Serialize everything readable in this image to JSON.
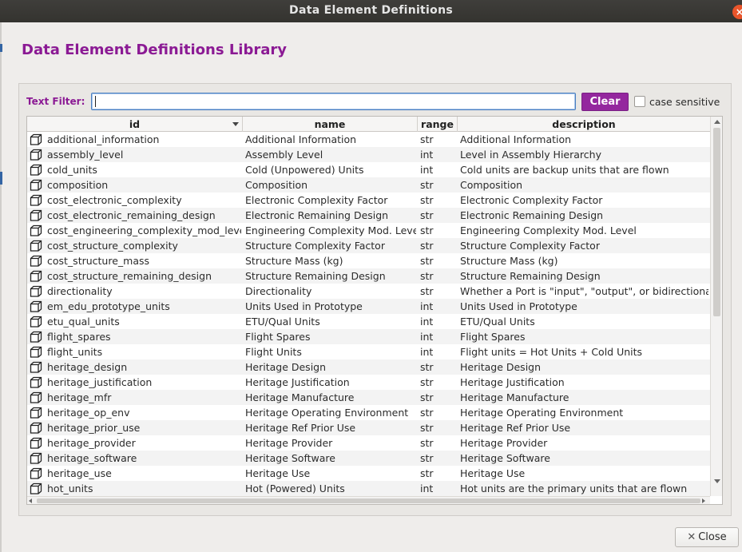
{
  "window": {
    "title": "Data Element Definitions",
    "close_icon": "close-icon"
  },
  "heading": "Data Element Definitions Library",
  "filter": {
    "label": "Text Filter:",
    "value": "",
    "clear_label": "Clear",
    "case_sensitive_label": "case sensitive",
    "case_sensitive_checked": false
  },
  "colors": {
    "accent": "#8b1a94",
    "button": "#94279e",
    "row_alt": "#f3f3f3"
  },
  "table": {
    "columns": [
      "id",
      "name",
      "range",
      "description"
    ],
    "sorted_column": "id",
    "row_icon": "cube-icon",
    "rows": [
      {
        "id": "additional_information",
        "name": "Additional Information",
        "range": "str",
        "description": "Additional Information"
      },
      {
        "id": "assembly_level",
        "name": "Assembly Level",
        "range": "int",
        "description": "Level in Assembly Hierarchy"
      },
      {
        "id": "cold_units",
        "name": "Cold (Unpowered) Units",
        "range": "int",
        "description": "Cold units are backup units that are flown"
      },
      {
        "id": "composition",
        "name": "Composition",
        "range": "str",
        "description": "Composition"
      },
      {
        "id": "cost_electronic_complexity",
        "name": "Electronic Complexity Factor",
        "range": "str",
        "description": "Electronic Complexity Factor"
      },
      {
        "id": "cost_electronic_remaining_design",
        "name": "Electronic Remaining Design",
        "range": "str",
        "description": "Electronic Remaining Design"
      },
      {
        "id": "cost_engineering_complexity_mod_level",
        "name": "Engineering Complexity Mod. Level",
        "range": "str",
        "description": "Engineering Complexity Mod. Level"
      },
      {
        "id": "cost_structure_complexity",
        "name": "Structure Complexity Factor",
        "range": "str",
        "description": "Structure Complexity Factor"
      },
      {
        "id": "cost_structure_mass",
        "name": "Structure Mass (kg)",
        "range": "str",
        "description": "Structure Mass (kg)"
      },
      {
        "id": "cost_structure_remaining_design",
        "name": "Structure Remaining Design",
        "range": "str",
        "description": "Structure Remaining Design"
      },
      {
        "id": "directionality",
        "name": "Directionality",
        "range": "str",
        "description": "Whether a Port is \"input\", \"output\", or bidirectional."
      },
      {
        "id": "em_edu_prototype_units",
        "name": "Units Used in Prototype",
        "range": "int",
        "description": "Units Used in Prototype"
      },
      {
        "id": "etu_qual_units",
        "name": "ETU/Qual Units",
        "range": "int",
        "description": "ETU/Qual Units"
      },
      {
        "id": "flight_spares",
        "name": "Flight Spares",
        "range": "int",
        "description": "Flight Spares"
      },
      {
        "id": "flight_units",
        "name": "Flight Units",
        "range": "int",
        "description": "Flight units = Hot Units + Cold Units"
      },
      {
        "id": "heritage_design",
        "name": "Heritage Design",
        "range": "str",
        "description": "Heritage Design"
      },
      {
        "id": "heritage_justification",
        "name": "Heritage Justification",
        "range": "str",
        "description": "Heritage Justification"
      },
      {
        "id": "heritage_mfr",
        "name": "Heritage Manufacture",
        "range": "str",
        "description": "Heritage Manufacture"
      },
      {
        "id": "heritage_op_env",
        "name": "Heritage Operating Environment",
        "range": "str",
        "description": "Heritage Operating Environment"
      },
      {
        "id": "heritage_prior_use",
        "name": "Heritage Ref Prior Use",
        "range": "str",
        "description": "Heritage Ref Prior Use"
      },
      {
        "id": "heritage_provider",
        "name": "Heritage Provider",
        "range": "str",
        "description": "Heritage Provider"
      },
      {
        "id": "heritage_software",
        "name": "Heritage Software",
        "range": "str",
        "description": "Heritage Software"
      },
      {
        "id": "heritage_use",
        "name": "Heritage Use",
        "range": "str",
        "description": "Heritage Use"
      },
      {
        "id": "hot_units",
        "name": "Hot (Powered) Units",
        "range": "int",
        "description": "Hot units are the primary units that are flown"
      }
    ]
  },
  "footer": {
    "close_label": "Close"
  }
}
